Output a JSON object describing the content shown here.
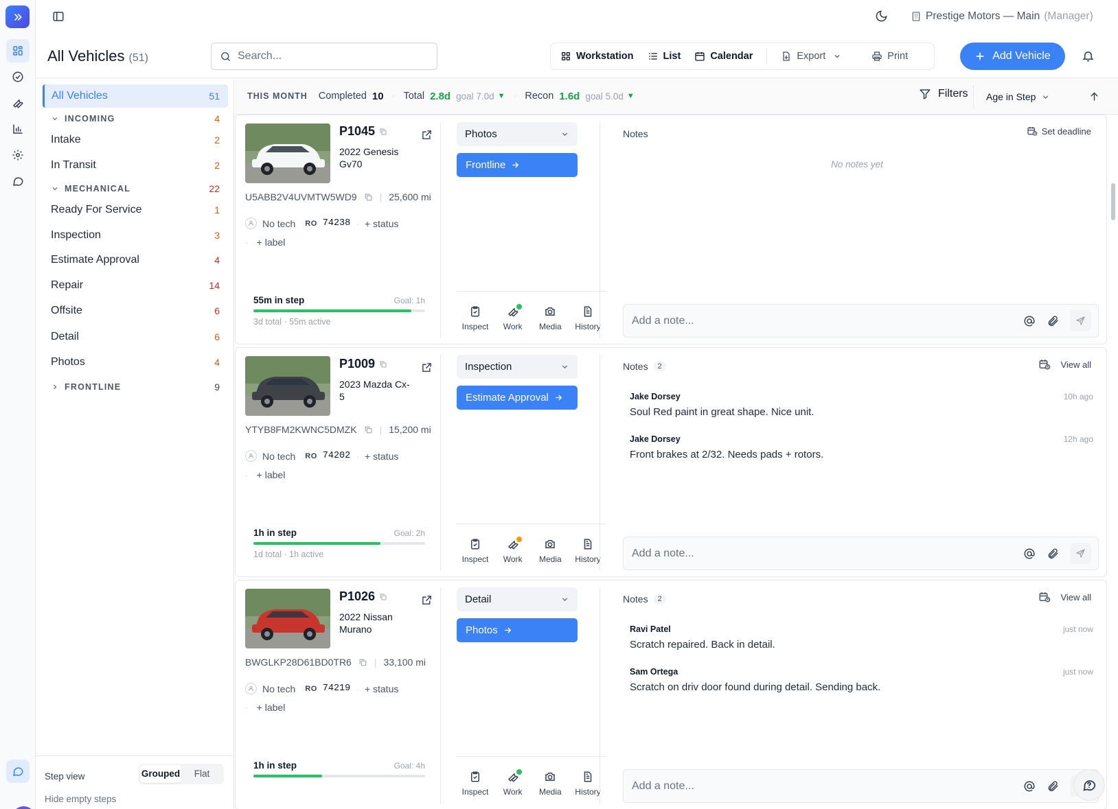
{
  "topbar": {
    "location": "Prestige Motors — Main",
    "role": "(Manager)"
  },
  "rail": {
    "items": [
      "dashboard",
      "tasks",
      "service",
      "reports",
      "settings",
      "messages"
    ]
  },
  "header": {
    "title": "All Vehicles",
    "count": "(51)",
    "search_placeholder": "Search...",
    "views": [
      "Workstation",
      "List",
      "Calendar"
    ],
    "export_label": "Export",
    "print_label": "Print",
    "add_vehicle_label": "Add Vehicle"
  },
  "steps": {
    "all": {
      "label": "All Vehicles",
      "count": "51"
    },
    "groups": [
      {
        "label": "INCOMING",
        "count": "4",
        "items": [
          {
            "label": "Intake",
            "count": "2"
          },
          {
            "label": "In Transit",
            "count": "2"
          }
        ]
      },
      {
        "label": "MECHANICAL",
        "count": "22",
        "items": [
          {
            "label": "Ready For Service",
            "count": "1"
          },
          {
            "label": "Inspection",
            "count": "3"
          },
          {
            "label": "Estimate Approval",
            "count": "4"
          },
          {
            "label": "Repair",
            "count": "14"
          },
          {
            "label": "Offsite",
            "count": "6"
          },
          {
            "label": "Detail",
            "count": "6"
          },
          {
            "label": "Photos",
            "count": "4"
          }
        ]
      },
      {
        "label": "FRONTLINE",
        "count": "9",
        "items": []
      }
    ],
    "footer": {
      "step_view_label": "Step view",
      "grouped": "Grouped",
      "flat": "Flat",
      "hide_empty": "Hide empty steps"
    }
  },
  "stats": {
    "period": "THIS MONTH",
    "completed_label": "Completed",
    "completed_value": "10",
    "total_label": "Total",
    "total_value": "2.8d",
    "total_goal": "goal 7.0d",
    "recon_label": "Recon",
    "recon_value": "1.6d",
    "recon_goal": "goal 5.0d",
    "filters_label": "Filters",
    "sort_label": "Age in Step"
  },
  "vehicles": [
    {
      "stock": "P1045",
      "ymm": "2022 Genesis Gv70",
      "vin": "U5ABB2V4UVMTW5WD9",
      "miles": "25,600 mi",
      "tech": "No tech",
      "ro_label": "RO",
      "ro": "74238",
      "status_link": "+ status",
      "label_link": "+ label",
      "in_step": "55m in step",
      "goal": "Goal: 1h",
      "progress": 0.92,
      "totals": "3d total  ·  55m active",
      "step": "Photos",
      "next_step": "Frontline",
      "work_dot": "#22c55e",
      "notes_label": "Notes",
      "notes_count": "",
      "notes_action": "Set deadline",
      "empty_notes": "No notes yet",
      "notes": [],
      "note_placeholder": "Add a note...",
      "car_color": "#f4f6f8"
    },
    {
      "stock": "P1009",
      "ymm": "2023 Mazda Cx-5",
      "vin": "YTYB8FM2KWNC5DMZK",
      "miles": "15,200 mi",
      "tech": "No tech",
      "ro_label": "RO",
      "ro": "74202",
      "status_link": "+ status",
      "label_link": "+ label",
      "in_step": "1h in step",
      "goal": "Goal: 2h",
      "progress": 0.74,
      "totals": "1d total  ·  1h active",
      "step": "Inspection",
      "next_step": "Estimate Approval",
      "work_dot": "#f59e0b",
      "notes_label": "Notes",
      "notes_count": "2",
      "notes_action": "View all",
      "empty_notes": "",
      "notes": [
        {
          "author": "Jake Dorsey",
          "when": "10h ago",
          "body": "Soul Red paint in great shape. Nice unit."
        },
        {
          "author": "Jake Dorsey",
          "when": "12h ago",
          "body": "Front brakes at 2/32. Needs pads + rotors."
        }
      ],
      "note_placeholder": "Add a note...",
      "car_color": "#3f4348"
    },
    {
      "stock": "P1026",
      "ymm": "2022 Nissan Murano",
      "vin": "BWGLKP28D61BD0TR6",
      "miles": "33,100 mi",
      "tech": "No tech",
      "ro_label": "RO",
      "ro": "74219",
      "status_link": "+ status",
      "label_link": "+ label",
      "in_step": "1h in step",
      "goal": "Goal: 4h",
      "progress": 0.4,
      "totals": "",
      "step": "Detail",
      "next_step": "Photos",
      "work_dot": "#22c55e",
      "notes_label": "Notes",
      "notes_count": "2",
      "notes_action": "View all",
      "empty_notes": "",
      "notes": [
        {
          "author": "Ravi Patel",
          "when": "just now",
          "body": "Scratch repaired. Back in detail."
        },
        {
          "author": "Sam Ortega",
          "when": "just now",
          "body": "Scratch on driv door found during detail. Sending back."
        }
      ],
      "note_placeholder": "Add a note...",
      "car_color": "#c8352f"
    }
  ],
  "actions": [
    "Inspect",
    "Work",
    "Media",
    "History"
  ],
  "colors": {
    "accent": "#3b82f6",
    "green": "#16a34a",
    "orange": "#ea580c",
    "red": "#dc2626"
  }
}
